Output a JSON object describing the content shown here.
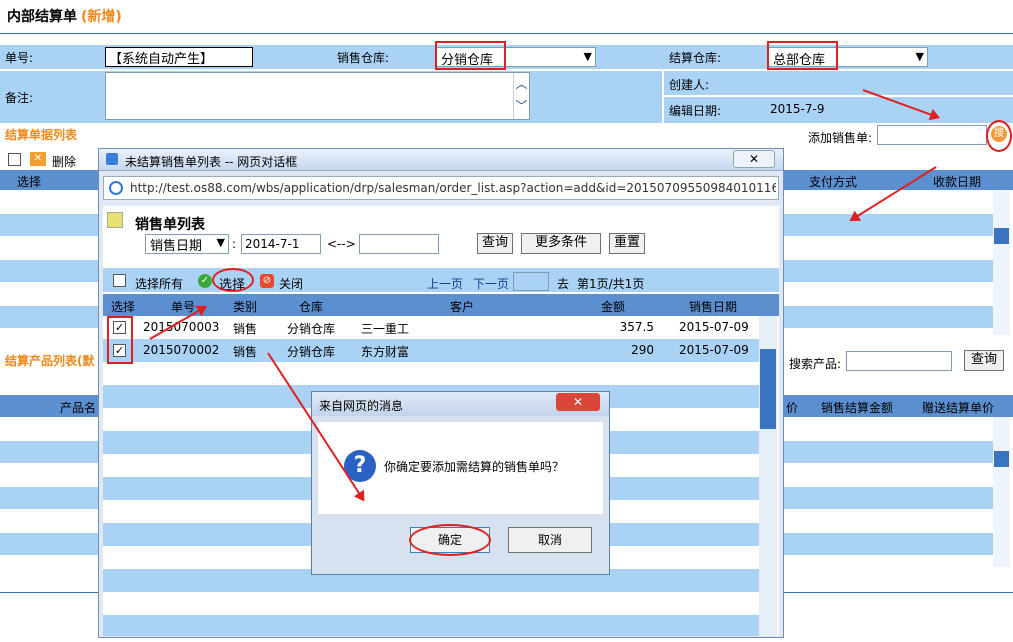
{
  "page": {
    "title": "内部结算单",
    "subtitle": "(新增)"
  },
  "form": {
    "order_no_label": "单号:",
    "order_no_value": "【系统自动产生】",
    "sales_wh_label": "销售仓库:",
    "sales_wh_value": "分销仓库",
    "settle_wh_label": "结算仓库:",
    "settle_wh_value": "总部仓库",
    "remark_label": "备注:",
    "creator_label": "创建人:",
    "edit_date_label": "编辑日期:",
    "edit_date_value": "2015-7-9",
    "add_order_label": "添加销售单:"
  },
  "list_section": {
    "title": "结算单据列表",
    "delete_label": "删除",
    "col_select": "选择",
    "col_pay": "支付方式",
    "col_recv_date": "收款日期"
  },
  "product_section": {
    "title": "结算产品列表(默",
    "search_label": "搜索产品:",
    "search_btn": "查询",
    "col_product": "产品名",
    "col_price": "价",
    "col_sales_amount": "销售结算金额",
    "col_gift_price": "赠送结算单价"
  },
  "dialog": {
    "title": "未结算销售单列表 -- 网页对话框",
    "url": "http://test.os88.com/wbs/application/drp/salesman/order_list.asp?action=add&id=201507095509840101168O",
    "header": "销售单列表",
    "date_field": "销售日期",
    "date_from": "2014-7-1",
    "range_sep": "<-->",
    "query_btn": "查询",
    "more_btn": "更多条件",
    "reset_btn": "重置",
    "select_all": "选择所有",
    "select_btn": "选择",
    "close_btn": "关闭",
    "prev": "上一页",
    "next": "下一页",
    "goto": "去",
    "page_info": "第1页/共1页",
    "columns": [
      "选择",
      "单号",
      "类别",
      "仓库",
      "客户",
      "金额",
      "销售日期"
    ],
    "rows": [
      {
        "no": "2015070003",
        "type": "销售",
        "wh": "分销仓库",
        "customer": "三一重工",
        "amount": "357.5",
        "date": "2015-07-09"
      },
      {
        "no": "2015070002",
        "type": "销售",
        "wh": "分销仓库",
        "customer": "东方财富",
        "amount": "290",
        "date": "2015-07-09"
      }
    ]
  },
  "msgbox": {
    "title": "来自网页的消息",
    "text": "你确定要添加需结算的销售单吗？",
    "ok": "确定",
    "cancel": "取消"
  },
  "colors": {
    "band": "#a9d2f5",
    "header": "#5b8fd0",
    "accent": "#f08a1c",
    "annotation": "#e02020"
  }
}
